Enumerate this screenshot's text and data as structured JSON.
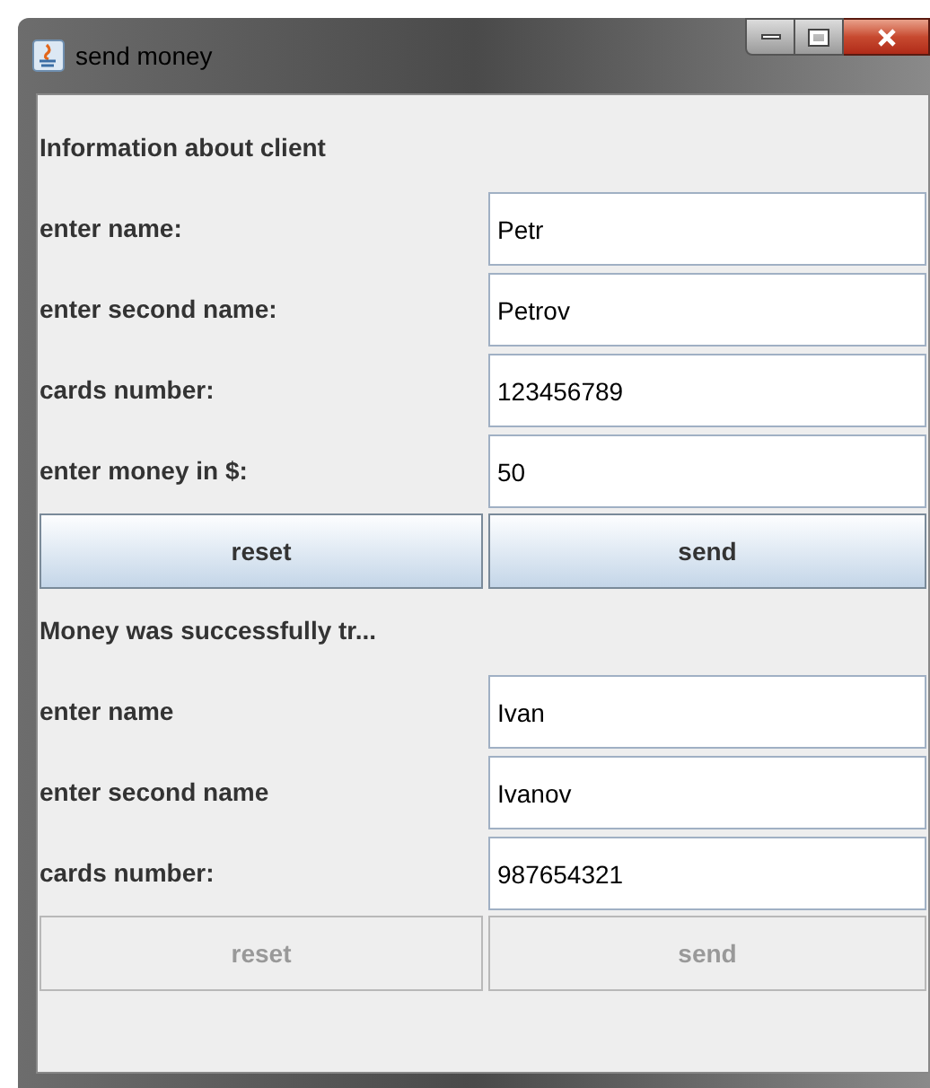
{
  "window": {
    "title": "send money"
  },
  "sections": [
    {
      "heading": "Information about client",
      "fields": [
        {
          "label": "enter name:",
          "value": "Petr"
        },
        {
          "label": "enter second name:",
          "value": "Petrov"
        },
        {
          "label": "cards number:",
          "value": "123456789"
        },
        {
          "label": "enter money in $:",
          "value": "50"
        }
      ],
      "buttons": [
        {
          "label": "reset",
          "disabled": false
        },
        {
          "label": "send",
          "disabled": false
        }
      ]
    },
    {
      "heading": "Money was successfully tr...",
      "fields": [
        {
          "label": "enter name",
          "value": "Ivan"
        },
        {
          "label": "enter second name",
          "value": "Ivanov"
        },
        {
          "label": "cards number:",
          "value": "987654321"
        }
      ],
      "buttons": [
        {
          "label": "reset",
          "disabled": true
        },
        {
          "label": "send",
          "disabled": true
        }
      ]
    }
  ]
}
